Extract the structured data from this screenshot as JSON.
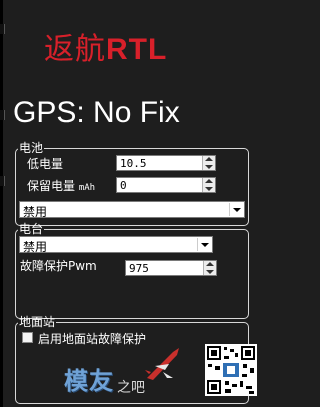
{
  "title": {
    "cjk": "返航",
    "latin": "RTL"
  },
  "gps_status": "GPS: No Fix",
  "battery": {
    "legend": "电池",
    "low_voltage_label": "低电量",
    "low_voltage_value": "10.5",
    "reserve_label": "保留电量",
    "reserve_unit": "mAh",
    "reserve_value": "0",
    "action_value": "禁用"
  },
  "radio": {
    "legend": "电台",
    "action_value": "禁用",
    "failsafe_pwm_label": "故障保护Pwm",
    "failsafe_pwm_value": "975"
  },
  "ground_station": {
    "legend": "地面站",
    "enable_label": "启用地面站故障保护",
    "enabled": false
  },
  "watermark": {
    "main": "模友",
    "sub": "之吧"
  },
  "colors": {
    "title_red": "#d8202a",
    "background": "#1e1e1e",
    "watermark_blue": "#6fa2d6"
  }
}
